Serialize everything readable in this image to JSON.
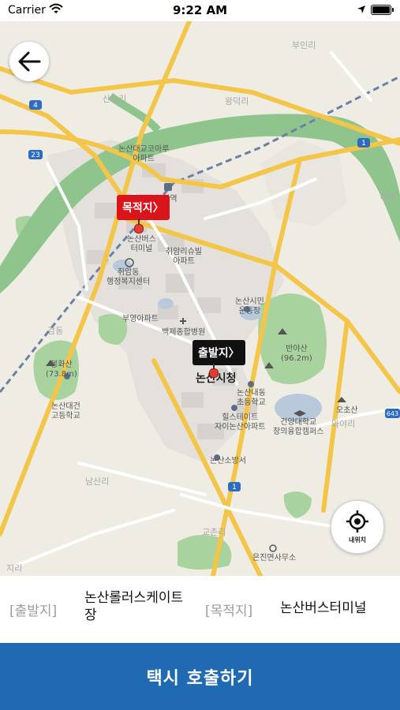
{
  "status_bar": {
    "carrier": "Carrier",
    "time": "9:22 AM"
  },
  "map": {
    "destination_tag": "목적지〉",
    "start_tag": "출발지〉",
    "my_location_label": "내위치",
    "labels": {
      "bu_in_ri": "부인리",
      "wang_deok_ri": "왕덕리",
      "san_no_ri": "산노리",
      "nonsan_bridge_apt": "논산대교코아루\n아파트",
      "nonsan_station": "논산역",
      "nonsan_bus_terminal": "논산버스\n터미널",
      "chwiam_dong_center": "취암동\n행정복지센터",
      "chwiam_apt": "취암리슈빌\n아파트",
      "buyoung_apt": "부영아파트",
      "baekje_hospital": "백제종합병원",
      "nonsan_city_hall": "논산시청",
      "citizen_stadium": "논산시민\n운동장",
      "banya_mountain": "반야산\n(96.2m)",
      "bonghwa_mountain": "봉화산\n(73.8m)",
      "daejeon_high": "논산대건\n고등학교",
      "naedong_elem": "논산내동\n초등학교",
      "hillstate_apt": "힐스테이트\n자이논산아파트",
      "konyang_univ": "건양대학교\n창의융합캠퍼스",
      "fire_station": "논산소방서",
      "namsan_ri": "남산리",
      "gyochon_ri": "교촌리",
      "eunjin_office": "은진면사무소",
      "ochosan": "오초산",
      "wayari": "와야리",
      "ahho": "아호",
      "ji_ri": "지리",
      "gam_dong": "감동",
      "road_4": "4",
      "road_23": "23",
      "road_1_north": "1",
      "road_1_south": "1",
      "road_643": "643"
    }
  },
  "route": {
    "start_label": "[출발지]",
    "start_value": "논산롤러스케이트장",
    "dest_label": "[목적지]",
    "dest_value": "논산버스터미널"
  },
  "call_button_label": "택시 호출하기",
  "colors": {
    "button_blue": "#1f6ab2",
    "dest_red": "#d9141b",
    "river_green": "#8fc58d",
    "highway_yellow": "#f3c64a"
  }
}
